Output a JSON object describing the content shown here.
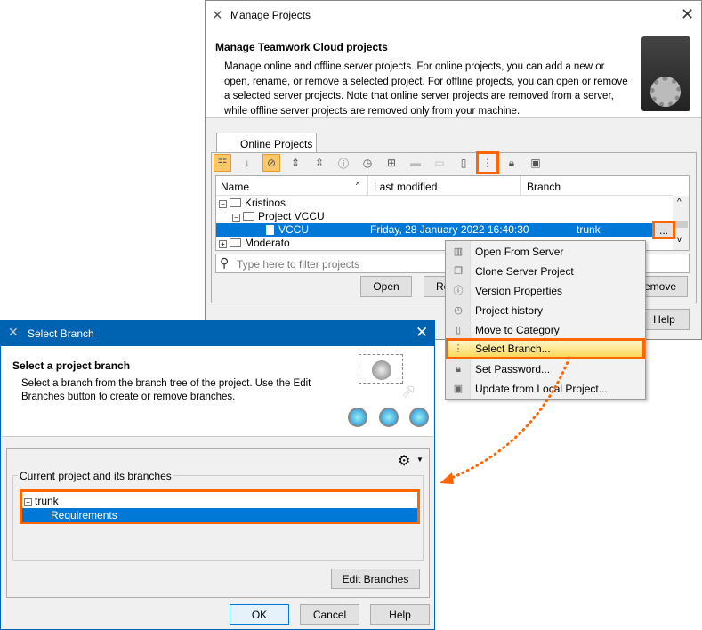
{
  "manage": {
    "title": "Manage Projects",
    "header_title": "Manage Teamwork Cloud projects",
    "header_desc": "Manage online and offline server projects. For online projects, you can add a new or open, rename, or remove a selected project. For offline projects, you can open or remove a selected server projects. Note that online server projects are removed from a server, while offline server projects are removed only from your machine.",
    "tab": "Online Projects",
    "columns": [
      "Name",
      "Last modified",
      "Branch"
    ],
    "rows": [
      {
        "name": "Kristinos",
        "modified": "",
        "branch": ""
      },
      {
        "name": "Project VCCU",
        "modified": "",
        "branch": ""
      },
      {
        "name": "VCCU",
        "modified": "Friday, 28 January 2022 16:40:30",
        "branch": "trunk"
      },
      {
        "name": "Moderato",
        "modified": "",
        "branch": ""
      }
    ],
    "more_button": "...",
    "filter_placeholder": "Type here to filter projects",
    "buttons": {
      "open": "Open",
      "rename": "Re",
      "remove": "emove",
      "help": "Help"
    }
  },
  "context_menu": [
    {
      "label": "Open From Server",
      "icon": "server-open-icon"
    },
    {
      "label": "Clone Server Project",
      "icon": "clone-icon"
    },
    {
      "label": "Version Properties",
      "icon": "info-icon"
    },
    {
      "label": "Project history",
      "icon": "history-icon"
    },
    {
      "label": "Move to Category",
      "icon": "category-icon"
    },
    {
      "label": "Select Branch...",
      "icon": "branch-icon",
      "highlighted": true
    },
    {
      "label": "Set Password...",
      "icon": "lock-icon"
    },
    {
      "label": "Update from Local Project...",
      "icon": "update-icon"
    }
  ],
  "branch_dialog": {
    "title": "Select Branch",
    "header_title": "Select a project branch",
    "header_desc": "Select a branch from the branch tree of the project. Use the Edit Branches button to create or remove branches.",
    "group_label": "Current project and its branches",
    "tree": [
      "trunk",
      "Requirements"
    ],
    "edit_branches": "Edit Branches",
    "ok": "OK",
    "cancel": "Cancel",
    "help": "Help"
  },
  "colors": {
    "accent": "#ff6600",
    "selection": "#0078d7",
    "titlebar": "#0063b1"
  }
}
